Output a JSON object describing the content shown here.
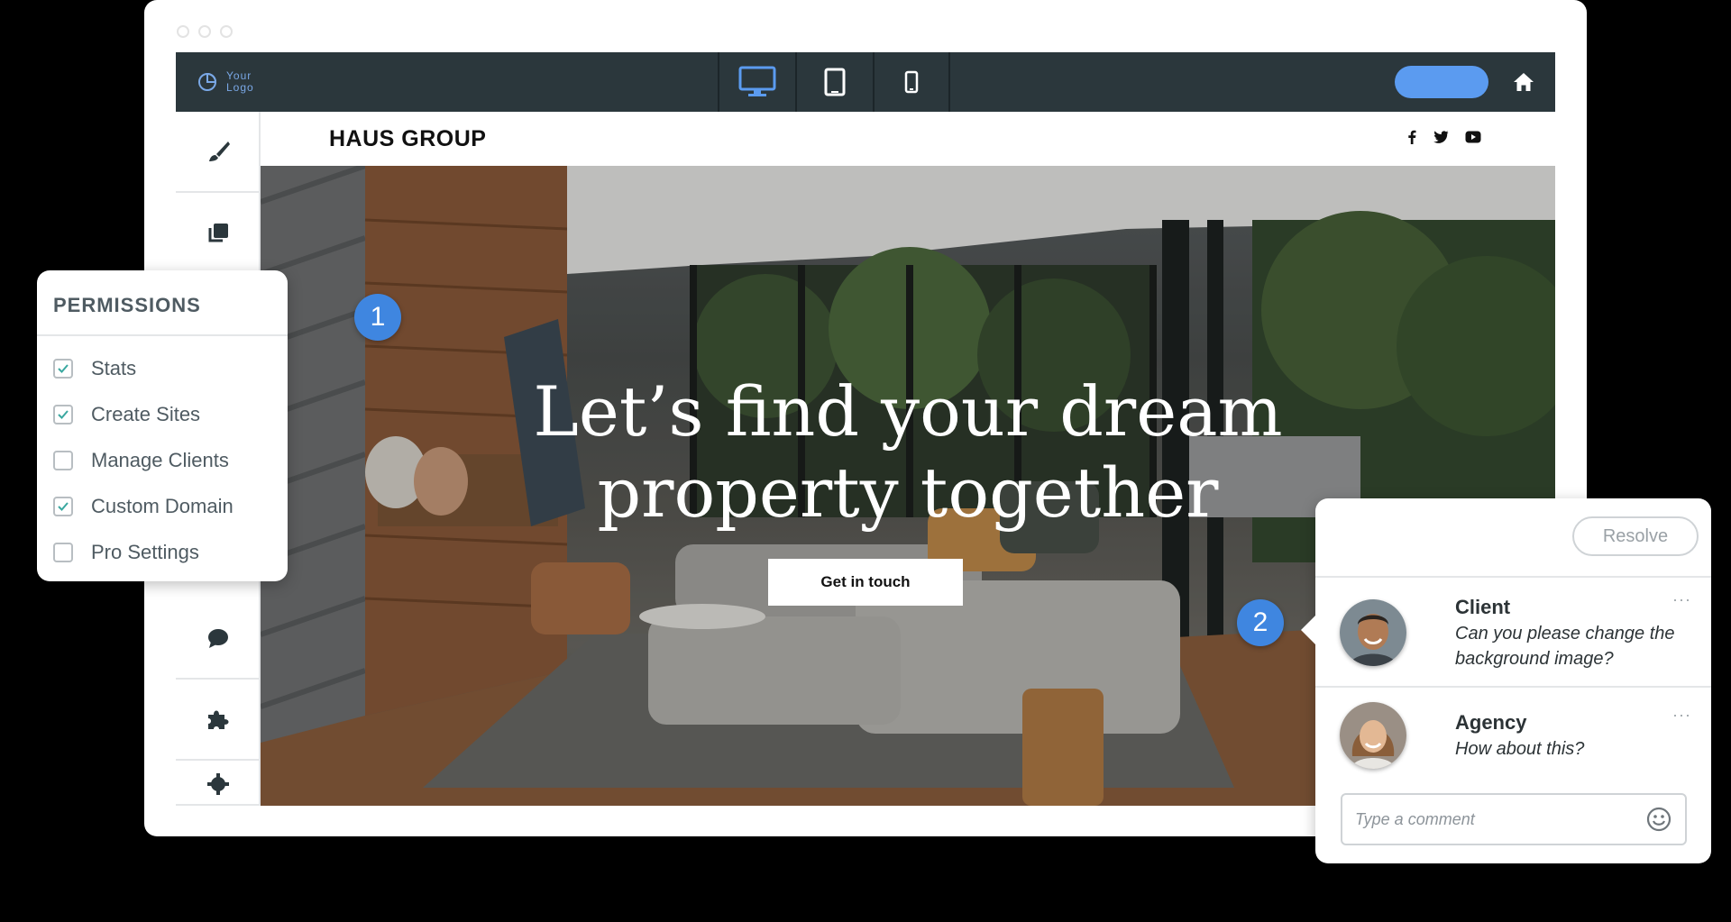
{
  "editor": {
    "logo_text": "Your Logo",
    "devices": [
      {
        "name": "desktop",
        "active": true
      },
      {
        "name": "tablet",
        "active": false
      },
      {
        "name": "mobile",
        "active": false
      }
    ],
    "accent_color": "#5b9bf0",
    "bar_color": "#2b373c"
  },
  "site": {
    "brand": "HAUS GROUP",
    "socials": [
      "facebook-icon",
      "twitter-icon",
      "youtube-icon"
    ],
    "hero_line1": "Let’s find your dream",
    "hero_line2": "property together",
    "cta_label": "Get in touch"
  },
  "sidebar_tools": [
    "brush-icon",
    "layers-icon",
    "chat-icon",
    "puzzle-icon",
    "gear-icon"
  ],
  "markers": [
    "1",
    "2"
  ],
  "permissions": {
    "title": "PERMISSIONS",
    "items": [
      {
        "label": "Stats",
        "checked": true
      },
      {
        "label": "Create Sites",
        "checked": true
      },
      {
        "label": "Manage Clients",
        "checked": false
      },
      {
        "label": "Custom Domain",
        "checked": true
      },
      {
        "label": "Pro Settings",
        "checked": false
      }
    ]
  },
  "comments": {
    "resolve_label": "Resolve",
    "more_label": "···",
    "items": [
      {
        "author": "Client",
        "text": "Can you please change the background image?"
      },
      {
        "author": "Agency",
        "text": "How about this?"
      }
    ],
    "input_placeholder": "Type a comment"
  }
}
